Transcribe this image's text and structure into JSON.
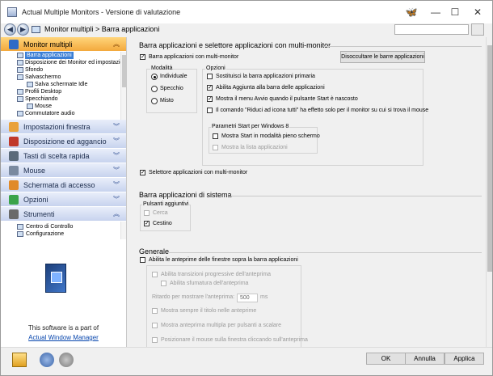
{
  "window": {
    "title": "Actual Multiple Monitors - Versione di valutazione",
    "minimize_glyph": "—",
    "maximize_glyph": "☐",
    "close_glyph": "✕"
  },
  "addressbar": {
    "back_glyph": "◀",
    "forward_glyph": "▶",
    "breadcrumb": "Monitor multipli > Barra applicazioni",
    "search_placeholder": ""
  },
  "sidebar": {
    "active_group": "Monitor multipli",
    "tree_items": [
      {
        "label": "Barra applicazioni",
        "selected": true,
        "indent": 1
      },
      {
        "label": "Disposizione dei Monitor ed impostazioni",
        "selected": false,
        "indent": 1
      },
      {
        "label": "Sfondo",
        "selected": false,
        "indent": 1
      },
      {
        "label": "Salvaschermo",
        "selected": false,
        "indent": 0
      },
      {
        "label": "Salva schermate Idle",
        "selected": false,
        "indent": 2
      },
      {
        "label": "Profili Desktop",
        "selected": false,
        "indent": 1
      },
      {
        "label": "Specchiando",
        "selected": false,
        "indent": 0
      },
      {
        "label": "Mouse",
        "selected": false,
        "indent": 2
      },
      {
        "label": "Commutatore audio",
        "selected": false,
        "indent": 1
      }
    ],
    "groups": [
      {
        "label": "Impostazioni finestra",
        "color": "#e9a13b"
      },
      {
        "label": "Disposizione ed aggancio",
        "color": "#c0392b"
      },
      {
        "label": "Tasti di scelta rapida",
        "color": "#5a6a7a"
      },
      {
        "label": "Mouse",
        "color": "#7a8aa0"
      },
      {
        "label": "Schermata di accesso",
        "color": "#e08a2a"
      },
      {
        "label": "Opzioni",
        "color": "#3aa34a"
      },
      {
        "label": "Strumenti",
        "color": "#6a6a6a"
      }
    ],
    "tools_items": [
      "Centro di Controllo",
      "Configurazione"
    ],
    "promo_text": "This software is a part of",
    "promo_link": "Actual Window Manager"
  },
  "taskbar_section": {
    "title": "Barra applicazioni e selettore applicazioni con multi-monitor",
    "enable_label": "Barra applicazioni con multi-monitor",
    "enable_checked": true,
    "unhide_button": "Disoccultare le barre applicazioni",
    "mode_title": "Modalità",
    "modes": [
      {
        "label": "Individuale",
        "selected": true
      },
      {
        "label": "Specchio",
        "selected": false
      },
      {
        "label": "Misto",
        "selected": false
      }
    ],
    "options_title": "Opzioni",
    "options": [
      {
        "label": "Sostituisci la barra applicazioni primaria",
        "checked": false
      },
      {
        "label": "Abilita Aggiunta alla barra delle applicazioni",
        "checked": true
      },
      {
        "label": "Mostra il menu Avvio quando il pulsante Start è nascosto",
        "checked": true
      },
      {
        "label": "Il comando \"Riduci ad icona tutti\" ha effetto solo per il monitor su cui si trova il mouse",
        "checked": false
      }
    ],
    "start_params_title": "Parametri Start per Windows 8",
    "start_params": [
      {
        "label": "Mostra Start in modalità pieno schermo",
        "checked": false,
        "disabled": false
      },
      {
        "label": "Mostra la lista applicazioni",
        "checked": false,
        "disabled": true
      }
    ],
    "switcher_label": "Selettore applicazioni con multi-monitor",
    "switcher_checked": true
  },
  "system_section": {
    "title": "Barra applicazioni di sistema",
    "extra_buttons_title": "Pulsanti aggiuntivi",
    "buttons": [
      {
        "label": "Cerca",
        "checked": false,
        "disabled": true
      },
      {
        "label": "Cestino",
        "checked": true,
        "disabled": false
      }
    ]
  },
  "general_section": {
    "title": "Generale",
    "preview_label": "Abilita le anteprime delle finestre sopra la barra applicazioni",
    "preview_checked": false,
    "sub_options": [
      {
        "label": "Abilita transizioni progressive dell'anteprima",
        "indent": 0
      },
      {
        "label": "Abilita sfumatura dell'anteprima",
        "indent": 1
      }
    ],
    "delay_label": "Ritardo per mostrare l'anteprima:",
    "delay_value": "500",
    "delay_unit": "ms",
    "more_options": [
      "Mostra sempre il titolo nelle anteprime",
      "Mostra anteprima multipla per pulsanti a scalare",
      "Posizionare il mouse sulla finestra cliccando sull'anteprima"
    ]
  },
  "footer": {
    "ok": "OK",
    "cancel": "Annulla",
    "apply": "Applica"
  }
}
